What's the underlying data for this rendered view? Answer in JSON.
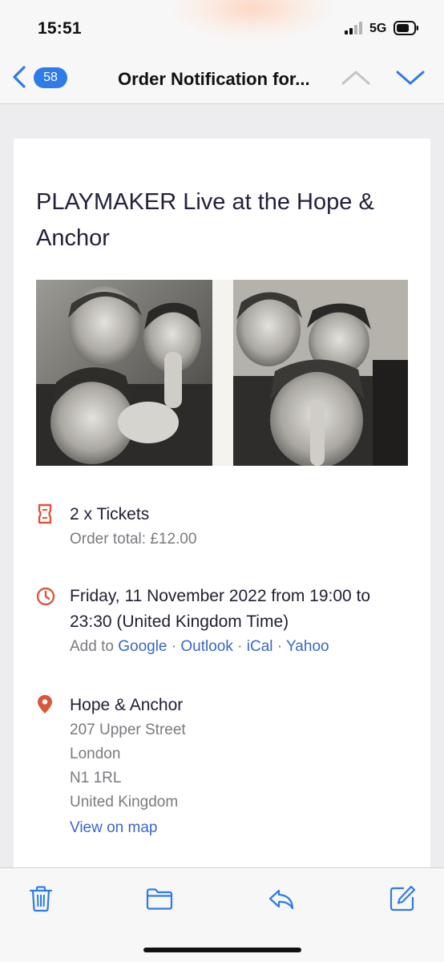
{
  "status_bar": {
    "time": "15:51",
    "network": "5G"
  },
  "nav": {
    "back_icon": "chevron-left-icon",
    "unread_count": "58",
    "title": "Order Notification for...",
    "up_icon": "chevron-up-icon",
    "down_icon": "chevron-down-icon"
  },
  "email": {
    "event_title": "PLAYMAKER Live at the Hope & Anchor",
    "tickets": {
      "icon": "ticket-icon",
      "label": "2 x Tickets",
      "order_total": "Order total: £12.00"
    },
    "datetime": {
      "icon": "clock-icon",
      "text": "Friday, 11 November 2022 from 19:00 to 23:30 (United Kingdom Time)",
      "add_to_prefix": "Add to",
      "calendars": [
        "Google",
        "Outlook",
        "iCal",
        "Yahoo"
      ],
      "separator": "·"
    },
    "venue": {
      "icon": "map-pin-icon",
      "name": "Hope & Anchor",
      "address_lines": [
        "207 Upper Street",
        "London",
        "N1 1RL",
        "United Kingdom"
      ],
      "map_link": "View on map"
    }
  },
  "toolbar": {
    "items": [
      "trash-icon",
      "folder-icon",
      "reply-icon",
      "compose-icon"
    ]
  },
  "colors": {
    "accent_blue": "#2f7be8",
    "link_blue": "#3a67c8",
    "icon_orange": "#d9573a",
    "title_navy": "#23223a"
  }
}
